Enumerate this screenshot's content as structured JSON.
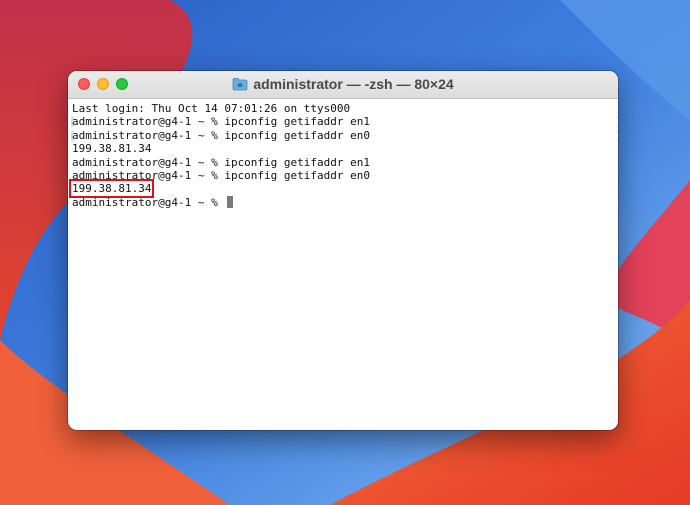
{
  "window": {
    "title": "administrator — -zsh — 80×24"
  },
  "terminal": {
    "lines": [
      "Last login: Thu Oct 14 07:01:26 on ttys000",
      "administrator@g4-1 ~ % ipconfig getifaddr en1",
      "administrator@g4-1 ~ % ipconfig getifaddr en0",
      "199.38.81.34",
      "administrator@g4-1 ~ % ipconfig getifaddr en1",
      "administrator@g4-1 ~ % ipconfig getifaddr en0",
      "199.38.81.34",
      "administrator@g4-1 ~ % "
    ]
  },
  "colors": {
    "highlight_box": "#e0101b",
    "close": "#fe5f57",
    "minimize": "#febc2e",
    "zoom": "#28c840"
  }
}
